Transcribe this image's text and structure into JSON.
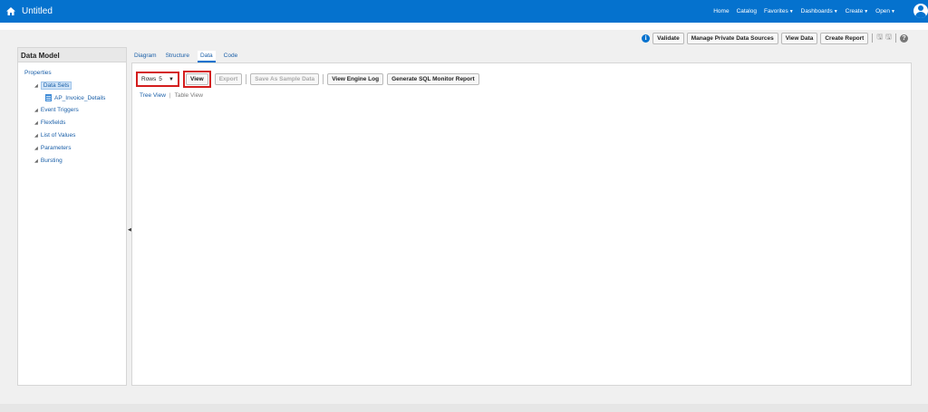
{
  "header": {
    "title": "Untitled",
    "nav": [
      "Home",
      "Catalog",
      "Favorites",
      "Dashboards",
      "Create",
      "Open"
    ]
  },
  "toolbar": {
    "validate": "Validate",
    "manage_private": "Manage Private Data Sources",
    "view_data": "View Data",
    "create_report": "Create Report"
  },
  "left_panel": {
    "title": "Data Model",
    "properties": "Properties",
    "data_sets": "Data Sets",
    "dataset_item": "AP_Invoice_Details",
    "event_triggers": "Event Triggers",
    "flexfields": "Flexfields",
    "list_of_values": "List of Values",
    "parameters": "Parameters",
    "bursting": "Bursting"
  },
  "tabs": [
    "Diagram",
    "Structure",
    "Data",
    "Code"
  ],
  "data_toolbar": {
    "rows_label": "Rows",
    "rows_value": "5",
    "view": "View",
    "export": "Export",
    "save_sample": "Save As Sample Data",
    "engine_log": "View Engine Log",
    "sql_monitor": "Generate SQL Monitor Report"
  },
  "view_links": {
    "tree": "Tree View",
    "separator": "|",
    "table": "Table View"
  },
  "colors": {
    "brand": "#0572ce",
    "highlight": "#d41d1d"
  }
}
